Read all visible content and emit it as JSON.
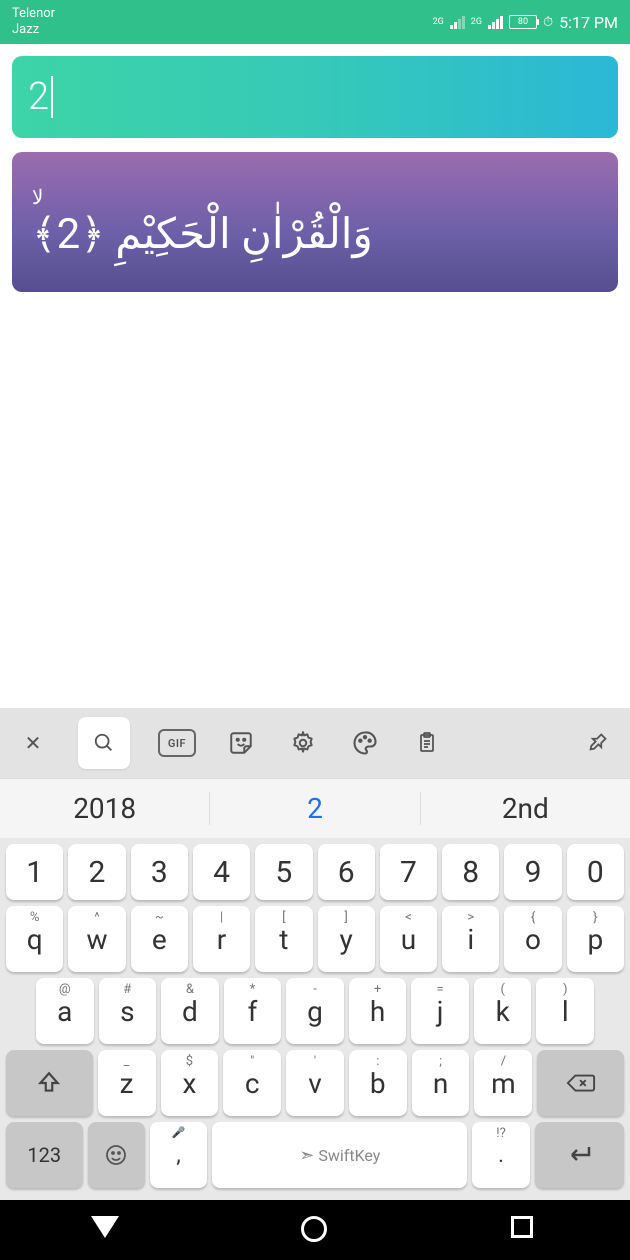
{
  "status": {
    "carrier1": "Telenor",
    "carrier2": "Jazz",
    "network": "2G",
    "battery": "80",
    "time": "5:17 PM"
  },
  "search": {
    "value": "2"
  },
  "verse": {
    "small_mark": "لا",
    "text": "وَالْقُرْاٰنِ الْحَكِيْمِ ﴿2﴾"
  },
  "toolbar": {
    "close": "✕",
    "gif": "GIF"
  },
  "suggestions": [
    "2018",
    "2",
    "2nd"
  ],
  "numbers": [
    "1",
    "2",
    "3",
    "4",
    "5",
    "6",
    "7",
    "8",
    "9",
    "0"
  ],
  "row_qwerty": [
    {
      "sub": "%",
      "main": "q"
    },
    {
      "sub": "^",
      "main": "w"
    },
    {
      "sub": "~",
      "main": "e"
    },
    {
      "sub": "|",
      "main": "r"
    },
    {
      "sub": "[",
      "main": "t"
    },
    {
      "sub": "]",
      "main": "y"
    },
    {
      "sub": "<",
      "main": "u"
    },
    {
      "sub": ">",
      "main": "i"
    },
    {
      "sub": "{",
      "main": "o"
    },
    {
      "sub": "}",
      "main": "p"
    }
  ],
  "row_asdf": [
    {
      "sub": "@",
      "main": "a"
    },
    {
      "sub": "#",
      "main": "s"
    },
    {
      "sub": "&",
      "main": "d"
    },
    {
      "sub": "*",
      "main": "f"
    },
    {
      "sub": "-",
      "main": "g"
    },
    {
      "sub": "+",
      "main": "h"
    },
    {
      "sub": "=",
      "main": "j"
    },
    {
      "sub": "(",
      "main": "k"
    },
    {
      "sub": ")",
      "main": "l"
    }
  ],
  "row_zxcv": [
    {
      "sub": "_",
      "main": "z"
    },
    {
      "sub": "$",
      "main": "x"
    },
    {
      "sub": "\"",
      "main": "c"
    },
    {
      "sub": "'",
      "main": "v"
    },
    {
      "sub": ":",
      "main": "b"
    },
    {
      "sub": ";",
      "main": "n"
    },
    {
      "sub": "/",
      "main": "m"
    }
  ],
  "bottom": {
    "switch": "123",
    "brand": "SwiftKey",
    "period_sub": "!?",
    "period": "."
  }
}
